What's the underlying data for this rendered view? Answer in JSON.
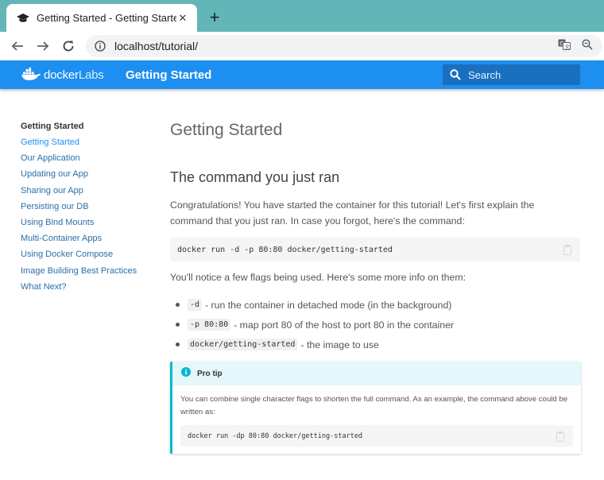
{
  "browser": {
    "tab_title": "Getting Started - Getting Started",
    "url": "localhost/tutorial/"
  },
  "header": {
    "logo_main": "docker",
    "logo_sub": "Labs",
    "site_title": "Getting Started",
    "search_placeholder": "Search"
  },
  "sidebar": {
    "heading": "Getting Started",
    "items": [
      {
        "label": "Getting Started",
        "active": true
      },
      {
        "label": "Our Application"
      },
      {
        "label": "Updating our App"
      },
      {
        "label": "Sharing our App"
      },
      {
        "label": "Persisting our DB"
      },
      {
        "label": "Using Bind Mounts"
      },
      {
        "label": "Multi-Container Apps"
      },
      {
        "label": "Using Docker Compose"
      },
      {
        "label": "Image Building Best Practices"
      },
      {
        "label": "What Next?"
      }
    ]
  },
  "content": {
    "title": "Getting Started",
    "section_heading": "The command you just ran",
    "intro": "Congratulations! You have started the container for this tutorial! Let's first explain the command that you just ran. In case you forgot, here's the command:",
    "command": "docker run -d -p 80:80 docker/getting-started",
    "flags_intro": "You'll notice a few flags being used. Here's some more info on them:",
    "bullets": [
      {
        "code": "-d",
        "text": "- run the container in detached mode (in the background)"
      },
      {
        "code": "-p 80:80",
        "text": "- map port 80 of the host to port 80 in the container"
      },
      {
        "code": "docker/getting-started",
        "text": "- the image to use"
      }
    ],
    "tip": {
      "title": "Pro tip",
      "body": "You can combine single character flags to shorten the full command. As an example, the command above could be written as:",
      "command": "docker run -dp 80:80 docker/getting-started"
    }
  },
  "colors": {
    "tab_strip": "#62b6b8",
    "header": "#1d8ff0",
    "search_bg": "#1a6fbf",
    "link": "#2a6fa8",
    "admonition_accent": "#00b8d4"
  }
}
